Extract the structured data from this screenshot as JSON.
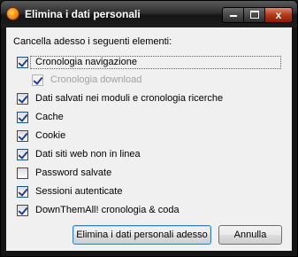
{
  "window": {
    "title": "Elimina i dati personali",
    "close_glyph": "x"
  },
  "dialog": {
    "heading": "Cancella adesso i seguenti elementi:",
    "items": [
      {
        "label": "Cronologia navigazione",
        "checked": true,
        "enabled": true
      },
      {
        "label": "Cronologia download",
        "checked": true,
        "enabled": false
      },
      {
        "label": "Dati salvati nei moduli e cronologia ricerche",
        "checked": true,
        "enabled": true
      },
      {
        "label": "Cache",
        "checked": true,
        "enabled": true
      },
      {
        "label": "Cookie",
        "checked": true,
        "enabled": true
      },
      {
        "label": "Dati siti web non in linea",
        "checked": true,
        "enabled": true
      },
      {
        "label": "Password salvate",
        "checked": false,
        "enabled": true
      },
      {
        "label": "Sessioni autenticate",
        "checked": true,
        "enabled": true
      },
      {
        "label": "DownThemAll! cronologia & coda",
        "checked": true,
        "enabled": true
      }
    ],
    "buttons": {
      "confirm": "Elimina i dati personali adesso",
      "cancel": "Annulla"
    }
  }
}
